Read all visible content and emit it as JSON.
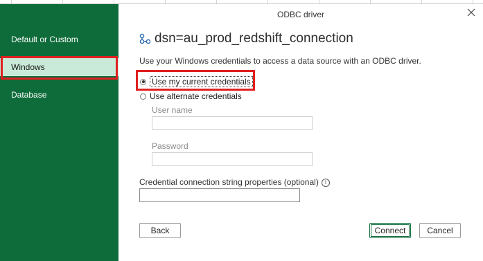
{
  "dialog": {
    "title": "ODBC driver",
    "close_icon": "close-icon"
  },
  "sidebar": {
    "items": [
      {
        "label": "Default or Custom",
        "selected": false
      },
      {
        "label": "Windows",
        "selected": true
      },
      {
        "label": "Database",
        "selected": false
      }
    ]
  },
  "main": {
    "dsn_icon": "connection-icon",
    "dsn_name": "dsn=au_prod_redshift_connection",
    "description": "Use your Windows credentials to access a data source with an ODBC driver.",
    "options": {
      "current": "Use my current credentials",
      "alternate": "Use alternate credentials",
      "selected": "current"
    },
    "username": {
      "label": "User name",
      "value": ""
    },
    "password": {
      "label": "Password",
      "value": ""
    },
    "credential_props": {
      "label": "Credential connection string properties (optional)",
      "value": ""
    }
  },
  "buttons": {
    "back": "Back",
    "connect": "Connect",
    "cancel": "Cancel"
  },
  "colors": {
    "sidebar_bg": "#0e6b3a",
    "selected_bg": "#c9ead8",
    "highlight": "#e02020"
  }
}
